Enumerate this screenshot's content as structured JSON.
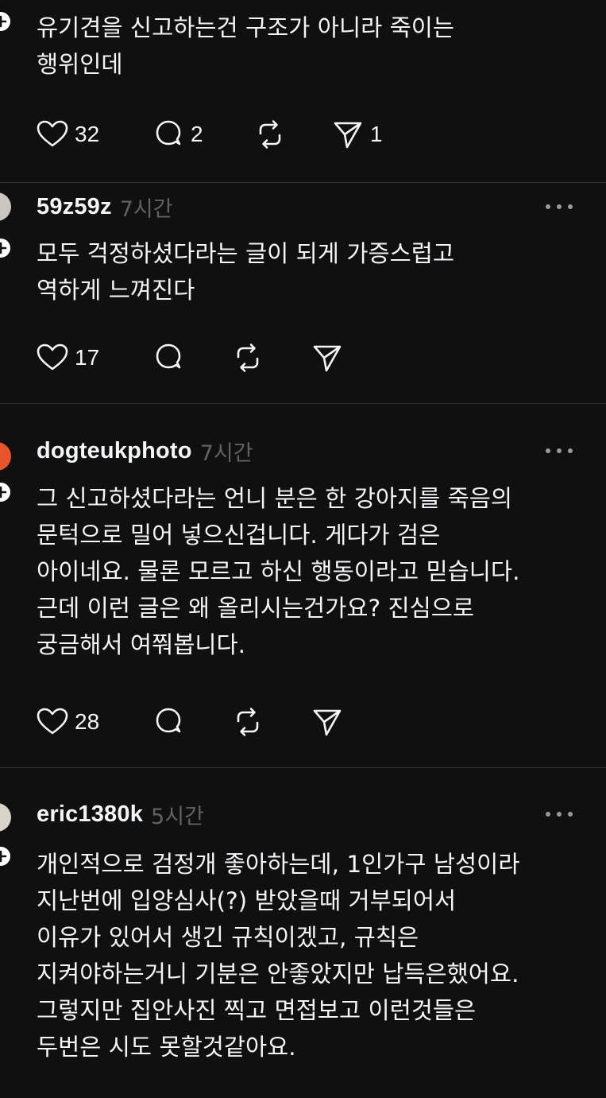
{
  "posts": [
    {
      "username": "",
      "time": "",
      "lines": [
        "유기견을 신고하는건 구조가 아니라 죽이는",
        "행위인데"
      ],
      "likes": "32",
      "replies": "2",
      "reposts": "",
      "shares": "1"
    },
    {
      "username": "59z59z",
      "time": "7시간",
      "lines": [
        "모두 걱정하셨다라는 글이 되게 가증스럽고",
        "역하게 느껴진다"
      ],
      "likes": "17",
      "replies": "",
      "reposts": "",
      "shares": ""
    },
    {
      "username": "dogteukphoto",
      "time": "7시간",
      "lines": [
        "그 신고하셨다라는 언니 분은 한 강아지를 죽음의",
        "문턱으로 밀어 넣으신겁니다. 게다가 검은",
        "아이네요. 물론 모르고 하신 행동이라고 믿습니다.",
        "근데 이런 글은 왜 올리시는건가요? 진심으로",
        "궁금해서 여쭤봅니다."
      ],
      "likes": "28",
      "replies": "",
      "reposts": "",
      "shares": ""
    },
    {
      "username": "eric1380k",
      "time": "5시간",
      "lines": [
        "개인적으로 검정개 좋아하는데, 1인가구 남성이라",
        "지난번에 입양심사(?) 받았을때 거부되어서",
        "이유가 있어서 생긴 규칙이겠고, 규칙은",
        "지켜야하는거니 기분은 안좋았지만 납득은했어요.",
        "그렇지만 집안사진 찍고 면접보고 이런것들은",
        "두번은 시도 못할것같아요."
      ],
      "likes": "",
      "replies": "",
      "reposts": "",
      "shares": ""
    }
  ],
  "icons": {
    "like": "heart-icon",
    "reply": "comment-icon",
    "repost": "repost-icon",
    "share": "send-icon",
    "more": "more-icon",
    "follow": "plus-icon"
  },
  "colors": {
    "background": "#101010",
    "text": "#f3f5f7",
    "secondary": "#616161",
    "divider": "#2d2d2d"
  }
}
